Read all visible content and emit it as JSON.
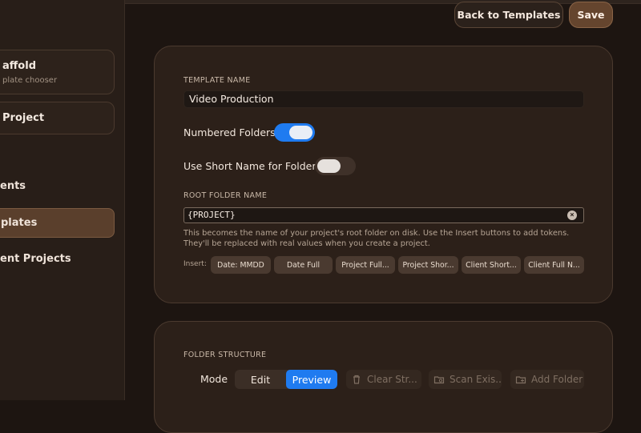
{
  "sidebar": {
    "scaffold_title": "affold",
    "scaffold_subtitle": "plate chooser",
    "new_project": "Project",
    "nav": [
      {
        "label": "ents"
      },
      {
        "label": "plates"
      },
      {
        "label": "ent Projects"
      }
    ]
  },
  "header": {
    "back_label": "Back to Templates",
    "save_label": "Save"
  },
  "template": {
    "name_label": "TEMPLATE NAME",
    "name_value": "Video Production",
    "numbered_label": "Numbered Folders",
    "numbered_on": true,
    "short_name_label": "Use Short Name for Folders",
    "short_name_on": false,
    "root_label": "ROOT FOLDER NAME",
    "root_value": "{PROJECT}",
    "help_line1": "This becomes the name of your project's root folder on disk. Use the Insert buttons to add tokens.",
    "help_line2": "They'll be replaced with real values when you create a project.",
    "insert_label": "Insert:",
    "tokens": [
      "Date: MMDD",
      "Date Full",
      "Project Full...",
      "Project Shor...",
      "Client Short...",
      "Client Full N..."
    ]
  },
  "folder": {
    "section_label": "FOLDER STRUCTURE",
    "mode_label": "Mode",
    "edit_label": "Edit",
    "preview_label": "Preview",
    "clear_label": "Clear Str...",
    "scan_label": "Scan Exis...",
    "add_label": "Add Folder"
  },
  "colors": {
    "accent": "#1f7bf0",
    "save": "#65452e",
    "active_nav": "#5a3f2c"
  }
}
